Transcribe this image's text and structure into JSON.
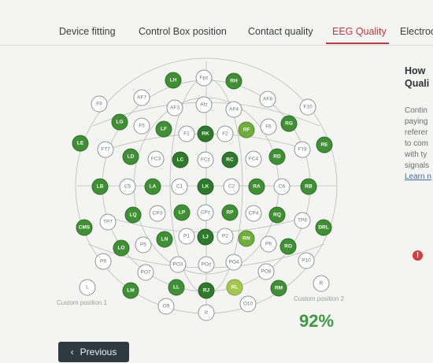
{
  "tabs": [
    {
      "label": "Device fitting"
    },
    {
      "label": "Control Box position"
    },
    {
      "label": "Contact quality"
    },
    {
      "label": "EEG Quality"
    },
    {
      "label": "Electroc"
    }
  ],
  "colors": {
    "green": "#3f8f33",
    "green_dark": "#2d6f28",
    "light_green": "#9ccf55",
    "accent": "#c9343c"
  },
  "electrodes": {
    "Fpz": "Fpz",
    "LH": "LH",
    "RH": "RH",
    "AF7": "AF7",
    "AF8": "AF8",
    "Afz": "Afz",
    "AF3": "AF3",
    "AF4": "AF4",
    "F9": "F9",
    "F10": "F10",
    "LG": "LG",
    "RG": "RG",
    "F5": "F5",
    "F6": "F6",
    "LF": "LF",
    "RF": "RF",
    "F1": "F1",
    "F2": "F2",
    "RK": "RK",
    "LE": "LE",
    "RE": "RE",
    "FT7": "FT7",
    "FT8": "FT8",
    "LD": "LD",
    "RD": "RD",
    "FC3": "FC3",
    "FC4": "FC4",
    "LC": "LC",
    "RC": "RC",
    "FCz": "FCz",
    "LB": "LB",
    "RB": "RB",
    "C5": "C5",
    "C6": "C6",
    "LA": "LA",
    "RA": "RA",
    "C1": "C1",
    "C2": "C2",
    "LK": "LK",
    "CMS": "CMS",
    "DRL": "DRL",
    "TP7": "TP7",
    "TP8": "TP8",
    "LQ": "LQ",
    "RQ": "RQ",
    "CP3": "CP3",
    "CP4": "CP4",
    "LP": "LP",
    "RP": "RP",
    "CPz": "CPz",
    "P9": "P9",
    "P10": "P10",
    "LO": "LO",
    "RO": "RO",
    "P5": "P5",
    "P6": "P6",
    "LN": "LN",
    "RN": "RN",
    "P1": "P1",
    "P2": "P2",
    "LJ": "LJ",
    "PO7": "PO7",
    "PO8": "PO8",
    "PO3": "PO3",
    "PO4": "PO4",
    "POz": "POz",
    "L": "L",
    "R": "R",
    "LM": "LM",
    "RM": "RM",
    "LL": "LL",
    "RL": "RL",
    "RJ": "RJ",
    "O9": "O9",
    "O10": "O10",
    "Iz": "Iz"
  },
  "sidebar": {
    "heading_1": "How",
    "heading_2": "Quali",
    "lines": [
      "Contin",
      "paying",
      "referer",
      "to com",
      "with ty",
      "signals"
    ],
    "link": "Learn n"
  },
  "custom_position_1": "Custom position 1",
  "custom_position_2": "Custom position 2",
  "quality_percent": "92%",
  "previous_label": "Previous"
}
